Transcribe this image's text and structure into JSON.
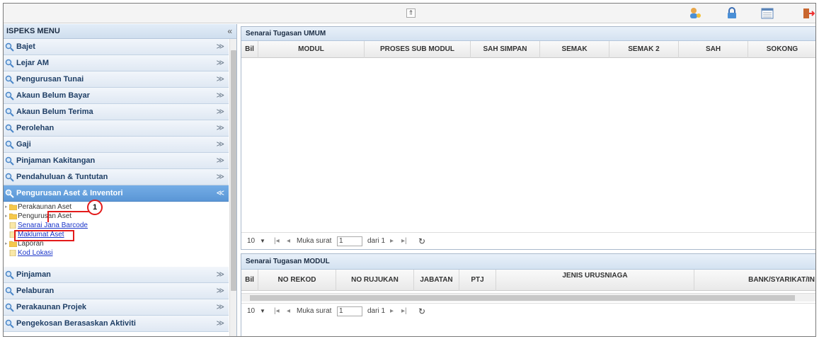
{
  "menu": {
    "title": "ISPEKS MENU",
    "collapse_glyph": "«",
    "items": [
      {
        "label": "Bajet"
      },
      {
        "label": "Lejar AM"
      },
      {
        "label": "Pengurusan Tunai"
      },
      {
        "label": "Akaun Belum Bayar"
      },
      {
        "label": "Akaun Belum Terima"
      },
      {
        "label": "Perolehan"
      },
      {
        "label": "Gaji"
      },
      {
        "label": "Pinjaman Kakitangan"
      },
      {
        "label": "Pendahuluan & Tuntutan"
      },
      {
        "label": "Pengurusan Aset & Inventori"
      },
      {
        "label": "Pinjaman"
      },
      {
        "label": "Pelaburan"
      },
      {
        "label": "Perakaunan Projek"
      },
      {
        "label": "Pengekosan Berasaskan Aktiviti"
      }
    ],
    "tree": [
      {
        "label": "Perakaunan Aset",
        "type": "folder"
      },
      {
        "label": "Pengurusan Aset",
        "type": "folder"
      },
      {
        "label": "Senarai Jana Barcode",
        "type": "page"
      },
      {
        "label": "Maklumat Aset",
        "type": "page"
      },
      {
        "label": "Laporan",
        "type": "folder"
      },
      {
        "label": "Kod Lokasi",
        "type": "page"
      }
    ],
    "active_index": 9
  },
  "annotation": {
    "step": "1"
  },
  "topbar": {
    "collapse_glyph": "⇑",
    "icons": [
      "user-icon",
      "lock-icon",
      "calendar-icon",
      "logout-icon"
    ]
  },
  "umum": {
    "title": "Senarai Tugasan UMUM",
    "columns": [
      "Bil",
      "MODUL",
      "PROSES SUB MODUL",
      "SAH SIMPAN",
      "SEMAK",
      "SEMAK 2",
      "SAH",
      "SOKONG"
    ],
    "pager": {
      "page_size": "10",
      "page_label": "Muka surat",
      "page": "1",
      "of_label": "dari 1"
    }
  },
  "modul": {
    "title": "Senarai Tugasan MODUL",
    "columns": [
      "Bil",
      "NO REKOD",
      "NO RUJUKAN",
      "JABATAN",
      "PTJ",
      "JENIS URUSNIAGA",
      "BANK/SYARIKAT/IN"
    ],
    "pager": {
      "page_size": "10",
      "page_label": "Muka surat",
      "page": "1",
      "of_label": "dari 1"
    }
  }
}
